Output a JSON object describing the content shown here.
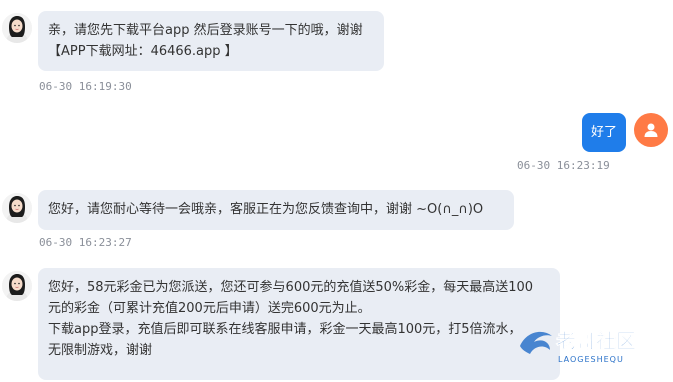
{
  "messages": [
    {
      "side": "left",
      "lines": [
        "亲，请您先下载平台app 然后登录账号一下的哦，谢谢",
        "【APP下载网址：46466.app 】"
      ],
      "time": "06-30 16:19:30"
    },
    {
      "side": "right",
      "lines": [
        "好了"
      ],
      "time": "06-30 16:23:19"
    },
    {
      "side": "left",
      "lines": [
        "您好，请您耐心等待一会哦亲，客服正在为您反馈查询中，谢谢 ~O(∩_∩)O"
      ],
      "time": "06-30 16:23:27"
    },
    {
      "side": "left",
      "lines": [
        "您好，58元彩金已为您派送，您还可参与600元的充值送50%彩金，每天最高送100",
        "元的彩金（可累计充值200元后申请）送完600元为止。",
        "下载app登录，充值后即可联系在线客服申请，彩金一天最高100元，打5倍流水，",
        "无限制游戏，谢谢"
      ],
      "time": ""
    }
  ],
  "watermark": {
    "title": "老哥社区",
    "subtitle": "LAOGESHEQU"
  },
  "icons": {
    "agent_avatar": "agent-avatar-icon",
    "user_avatar": "user-icon"
  },
  "colors": {
    "agent_bubble": "#e9edf4",
    "user_bubble": "#1f7dea",
    "user_avatar": "#ff7a45"
  }
}
